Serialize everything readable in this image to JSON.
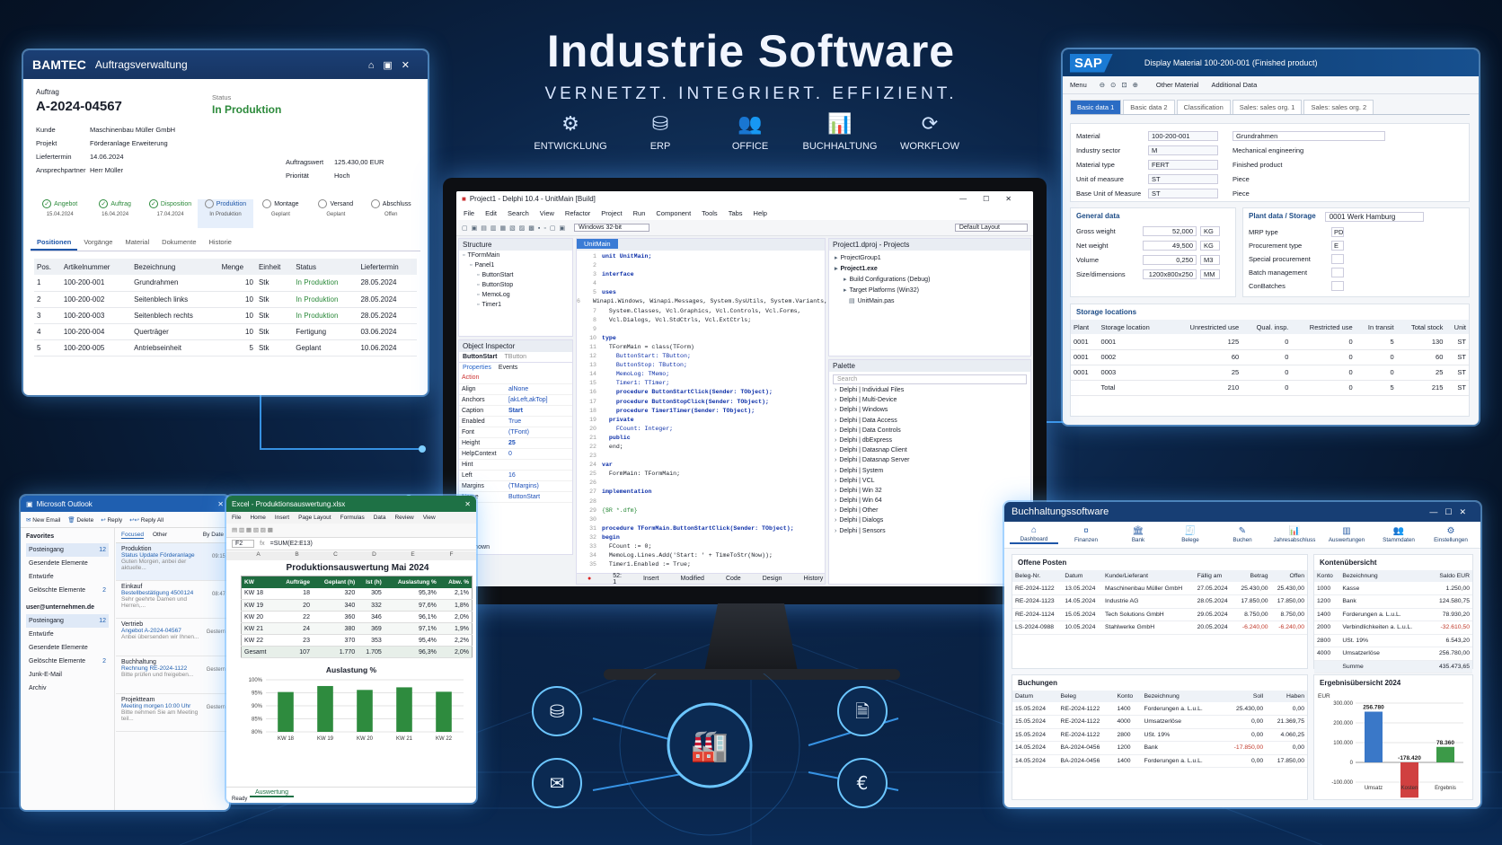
{
  "hero": {
    "title": "Industrie Software",
    "tagline": "VERNETZT. INTEGRIERT. EFFIZIENT.",
    "categories": [
      {
        "label": "ENTWICKLUNG",
        "icon": "gear-icon"
      },
      {
        "label": "ERP",
        "icon": "database-icon"
      },
      {
        "label": "OFFICE",
        "icon": "people-icon"
      },
      {
        "label": "BUCHHALTUNG",
        "icon": "chart-icon"
      },
      {
        "label": "WORKFLOW",
        "icon": "refresh-icon"
      }
    ]
  },
  "bamtec": {
    "brand": "BAMTEC",
    "title": "Auftragsverwaltung",
    "auftrag_label": "Auftrag",
    "auftrag_no": "A-2024-04567",
    "status_label": "Status",
    "status": "In Produktion",
    "fields": [
      {
        "label": "Kunde",
        "value": "Maschinenbau Müller GmbH"
      },
      {
        "label": "Projekt",
        "value": "Förderanlage Erweiterung"
      },
      {
        "label": "Liefertermin",
        "value": "14.06.2024"
      },
      {
        "label": "Ansprechpartner",
        "value": "Herr Müller"
      }
    ],
    "fields_right": [
      {
        "label": "Auftragswert",
        "value": "125.430,00 EUR"
      },
      {
        "label": "Priorität",
        "value": "Hoch"
      }
    ],
    "steps": [
      {
        "label": "Angebot",
        "date": "15.04.2024"
      },
      {
        "label": "Auftrag",
        "date": "16.04.2024"
      },
      {
        "label": "Disposition",
        "date": "17.04.2024"
      },
      {
        "label": "Produktion",
        "date": "In Produktion"
      },
      {
        "label": "Montage",
        "date": "Geplant"
      },
      {
        "label": "Versand",
        "date": "Geplant"
      },
      {
        "label": "Abschluss",
        "date": "Offen"
      }
    ],
    "tabs": [
      "Positionen",
      "Vorgänge",
      "Material",
      "Dokumente",
      "Historie"
    ],
    "columns": [
      "Pos.",
      "Artikelnummer",
      "Bezeichnung",
      "Menge",
      "Einheit",
      "Status",
      "Liefertermin"
    ],
    "rows": [
      [
        "1",
        "100-200-001",
        "Grundrahmen",
        "10",
        "Stk",
        "In Produktion",
        "28.05.2024"
      ],
      [
        "2",
        "100-200-002",
        "Seitenblech links",
        "10",
        "Stk",
        "In Produktion",
        "28.05.2024"
      ],
      [
        "3",
        "100-200-003",
        "Seitenblech rechts",
        "10",
        "Stk",
        "In Produktion",
        "28.05.2024"
      ],
      [
        "4",
        "100-200-004",
        "Querträger",
        "10",
        "Stk",
        "Fertigung",
        "03.06.2024"
      ],
      [
        "5",
        "100-200-005",
        "Antriebseinheit",
        "5",
        "Stk",
        "Geplant",
        "10.06.2024"
      ]
    ]
  },
  "sap": {
    "logo": "SAP",
    "title": "Display Material 100-200-001 (Finished product)",
    "menu": "Menu",
    "toolbar_items": [
      "Other Material",
      "Additional Data"
    ],
    "tabs": [
      "Basic data 1",
      "Basic data 2",
      "Classification",
      "Sales: sales org. 1",
      "Sales: sales org. 2"
    ],
    "fields": [
      {
        "label": "Material",
        "value": "100-200-001",
        "extra": "Grundrahmen"
      },
      {
        "label": "Industry sector",
        "value": "M",
        "extra": "Mechanical engineering"
      },
      {
        "label": "Material type",
        "value": "FERT",
        "extra": "Finished product"
      },
      {
        "label": "Unit of measure",
        "value": "ST",
        "extra": "Piece"
      },
      {
        "label": "Base Unit of Measure",
        "value": "ST",
        "extra": "Piece"
      }
    ],
    "general_title": "General data",
    "general": [
      {
        "label": "Gross weight",
        "value": "52,000",
        "unit": "KG"
      },
      {
        "label": "Net weight",
        "value": "49,500",
        "unit": "KG"
      },
      {
        "label": "Volume",
        "value": "0,250",
        "unit": "M3"
      },
      {
        "label": "Size/dimensions",
        "value": "1200x800x250",
        "unit": "MM"
      }
    ],
    "plant_title": "Plant data / Storage",
    "plant_value": "0001 Werk Hamburg",
    "plant": [
      {
        "label": "MRP type",
        "value": "PD"
      },
      {
        "label": "Procurement type",
        "value": "E"
      },
      {
        "label": "Special procurement",
        "value": ""
      },
      {
        "label": "Batch management",
        "value": ""
      },
      {
        "label": "ConBatches",
        "value": ""
      }
    ],
    "storage_title": "Storage locations",
    "storage_columns": [
      "Plant",
      "Storage location",
      "Unrestricted use",
      "Qual. insp.",
      "Restricted use",
      "In transit",
      "Total stock",
      "Unit"
    ],
    "storage_rows": [
      [
        "0001",
        "0001",
        "125",
        "0",
        "0",
        "5",
        "130",
        "ST"
      ],
      [
        "0001",
        "0002",
        "60",
        "0",
        "0",
        "0",
        "60",
        "ST"
      ],
      [
        "0001",
        "0003",
        "25",
        "0",
        "0",
        "0",
        "25",
        "ST"
      ],
      [
        "",
        "Total",
        "210",
        "0",
        "0",
        "5",
        "215",
        "ST"
      ]
    ]
  },
  "delphi": {
    "title": "Project1 - Delphi 10.4 - UnitMain [Build]",
    "menu": [
      "File",
      "Edit",
      "Search",
      "View",
      "Refactor",
      "Project",
      "Run",
      "Component",
      "Tools",
      "Tabs",
      "Help"
    ],
    "layout": "Default Layout",
    "platform": "Windows 32-bit",
    "structure_title": "Structure",
    "structure": [
      "TFormMain",
      "Panel1",
      "ButtonStart",
      "ButtonStop",
      "MemoLog",
      "Timer1"
    ],
    "inspector_title": "Object Inspector",
    "inspector_obj": "ButtonStart",
    "inspector_type": "TButton",
    "inspector_tabs": [
      "Properties",
      "Events"
    ],
    "props": [
      [
        "Action",
        ""
      ],
      [
        "Align",
        "alNone"
      ],
      [
        "Anchors",
        "[akLeft,akTop]"
      ],
      [
        "Caption",
        "Start"
      ],
      [
        "Enabled",
        "True"
      ],
      [
        "Font",
        "(TFont)"
      ],
      [
        "Height",
        "25"
      ],
      [
        "HelpContext",
        "0"
      ],
      [
        "Hint",
        ""
      ],
      [
        "Left",
        "16"
      ],
      [
        "Margins",
        "(TMargins)"
      ],
      [
        "Name",
        "ButtonStart"
      ]
    ],
    "all_shown": "All shown",
    "editor_tab": "UnitMain",
    "code": [
      "unit UnitMain;",
      "",
      "interface",
      "",
      "uses",
      "  Winapi.Windows, Winapi.Messages, System.SysUtils, System.Variants,",
      "  System.Classes, Vcl.Graphics, Vcl.Controls, Vcl.Forms,",
      "  Vcl.Dialogs, Vcl.StdCtrls, Vcl.ExtCtrls;",
      "",
      "type",
      "  TFormMain = class(TForm)",
      "    ButtonStart: TButton;",
      "    ButtonStop: TButton;",
      "    MemoLog: TMemo;",
      "    Timer1: TTimer;",
      "    procedure ButtonStartClick(Sender: TObject);",
      "    procedure ButtonStopClick(Sender: TObject);",
      "    procedure Timer1Timer(Sender: TObject);",
      "  private",
      "    FCount: Integer;",
      "  public",
      "  end;",
      "",
      "var",
      "  FormMain: TFormMain;",
      "",
      "implementation",
      "",
      "{$R *.dfm}",
      "",
      "procedure TFormMain.ButtonStartClick(Sender: TObject);",
      "begin",
      "  FCount := 0;",
      "  MemoLog.Lines.Add('Start: ' + TimeToStr(Now));",
      "  Timer1.Enabled := True;"
    ],
    "status": [
      "52: 1",
      "Insert",
      "Modified"
    ],
    "editor_tabs": [
      "Code",
      "Design",
      "History"
    ],
    "projects_title": "Project1.dproj - Projects",
    "projects": [
      "ProjectGroup1",
      "Project1.exe",
      "Build Configurations (Debug)",
      "Target Platforms (Win32)",
      "UnitMain.pas"
    ],
    "palette_title": "Palette",
    "palette_search": "Search",
    "palette": [
      "Delphi | Individual Files",
      "Delphi | Multi-Device",
      "Delphi | Windows",
      "Delphi | Data Access",
      "Delphi | Data Controls",
      "Delphi | dbExpress",
      "Delphi | Datasnap Client",
      "Delphi | Datasnap Server",
      "Delphi | System",
      "Delphi | VCL",
      "Delphi | Win 32",
      "Delphi | Win 64",
      "Delphi | Other",
      "Delphi | Dialogs",
      "Delphi | Sensors"
    ]
  },
  "outlook": {
    "title": "Microsoft Outlook",
    "toolbar": [
      "New Email",
      "Delete",
      "Reply",
      "Reply All"
    ],
    "favorites_title": "Favorites",
    "favorites": [
      {
        "label": "Posteingang",
        "count": "12"
      },
      {
        "label": "Gesendete Elemente",
        "count": ""
      },
      {
        "label": "Entwürfe",
        "count": ""
      },
      {
        "label": "Gelöschte Elemente",
        "count": "2"
      }
    ],
    "account": "user@unternehmen.de",
    "folders": [
      {
        "label": "Posteingang",
        "count": "12"
      },
      {
        "label": "Entwürfe",
        "count": ""
      },
      {
        "label": "Gesendete Elemente",
        "count": ""
      },
      {
        "label": "Gelöschte Elemente",
        "count": "2"
      },
      {
        "label": "Junk-E-Mail",
        "count": ""
      },
      {
        "label": "Archiv",
        "count": ""
      }
    ],
    "list_tabs": [
      "Focused",
      "Other",
      "By Date"
    ],
    "mails": [
      {
        "from": "Produktion",
        "subject": "Status Update Förderanlage",
        "preview": "Guten Morgen, anbei der aktuelle...",
        "time": "09:15"
      },
      {
        "from": "Einkauf",
        "subject": "Bestellbestätigung 4500124",
        "preview": "Sehr geehrte Damen und Herren,...",
        "time": "08:47"
      },
      {
        "from": "Vertrieb",
        "subject": "Angebot A-2024-04567",
        "preview": "Anbei übersenden wir Ihnen...",
        "time": "Gestern"
      },
      {
        "from": "Buchhaltung",
        "subject": "Rechnung RE-2024-1122",
        "preview": "Bitte prüfen und freigeben...",
        "time": "Gestern"
      },
      {
        "from": "Projektteam",
        "subject": "Meeting morgen 10:00 Uhr",
        "preview": "Bitte nehmen Sie am Meeting teil...",
        "time": "Gestern"
      }
    ]
  },
  "excel": {
    "title": "Excel - Produktionsauswertung.xlsx",
    "ribbon": [
      "File",
      "Home",
      "Insert",
      "Page Layout",
      "Formulas",
      "Data",
      "Review",
      "View"
    ],
    "cell": "F2",
    "formula": "=SUM(E2:E13)",
    "sheet_title": "Produktionsauswertung Mai 2024",
    "col_letters": [
      "A",
      "B",
      "C",
      "D",
      "E",
      "F"
    ],
    "columns": [
      "KW",
      "Aufträge",
      "Geplant (h)",
      "Ist (h)",
      "Auslastung %",
      "Abw. %"
    ],
    "rows": [
      [
        "KW 18",
        "18",
        "320",
        "305",
        "95,3%",
        "2,1%"
      ],
      [
        "KW 19",
        "20",
        "340",
        "332",
        "97,6%",
        "1,8%"
      ],
      [
        "KW 20",
        "22",
        "360",
        "346",
        "96,1%",
        "2,0%"
      ],
      [
        "KW 21",
        "24",
        "380",
        "369",
        "97,1%",
        "1,9%"
      ],
      [
        "KW 22",
        "23",
        "370",
        "353",
        "95,4%",
        "2,2%"
      ],
      [
        "Gesamt",
        "107",
        "1.770",
        "1.705",
        "96,3%",
        "2,0%"
      ]
    ],
    "sheet_tab": "Auswertung",
    "status": "Ready"
  },
  "buch": {
    "title": "Buchhaltungssoftware",
    "nav": [
      {
        "label": "Dashboard",
        "icon": "home-icon"
      },
      {
        "label": "Finanzen",
        "icon": "coins-icon"
      },
      {
        "label": "Bank",
        "icon": "bank-icon"
      },
      {
        "label": "Belege",
        "icon": "receipt-icon"
      },
      {
        "label": "Buchen",
        "icon": "pen-icon"
      },
      {
        "label": "Jahresabschluss",
        "icon": "chart-icon"
      },
      {
        "label": "Auswertungen",
        "icon": "bar-chart-icon"
      },
      {
        "label": "Stammdaten",
        "icon": "people-icon"
      },
      {
        "label": "Einstellungen",
        "icon": "gear-icon"
      }
    ],
    "op_title": "Offene Posten",
    "op_columns": [
      "Beleg-Nr.",
      "Datum",
      "Kunde/Lieferant",
      "Fällig am",
      "Betrag",
      "Offen"
    ],
    "op_rows": [
      [
        "RE-2024-1122",
        "13.05.2024",
        "Maschinenbau Müller GmbH",
        "27.05.2024",
        "25.430,00",
        "25.430,00"
      ],
      [
        "RE-2024-1123",
        "14.05.2024",
        "Industrie AG",
        "28.05.2024",
        "17.850,00",
        "17.850,00"
      ],
      [
        "RE-2024-1124",
        "15.05.2024",
        "Tech Solutions GmbH",
        "29.05.2024",
        "8.750,00",
        "8.750,00"
      ],
      [
        "LS-2024-0988",
        "10.05.2024",
        "Stahlwerke GmbH",
        "20.05.2024",
        "-6.240,00",
        "-6.240,00"
      ]
    ],
    "ko_title": "Kontenübersicht",
    "ko_columns": [
      "Konto",
      "Bezeichnung",
      "Saldo EUR"
    ],
    "ko_rows": [
      [
        "1000",
        "Kasse",
        "1.250,00"
      ],
      [
        "1200",
        "Bank",
        "124.580,75"
      ],
      [
        "1400",
        "Forderungen a. L.u.L.",
        "78.930,20"
      ],
      [
        "2000",
        "Verbindlichkeiten a. L.u.L.",
        "-32.610,50"
      ],
      [
        "2800",
        "USt. 19%",
        "6.543,20"
      ],
      [
        "4000",
        "Umsatzerlöse",
        "256.780,00"
      ],
      [
        "",
        "Summe",
        "435.473,65"
      ]
    ],
    "bu_title": "Buchungen",
    "bu_columns": [
      "Datum",
      "Beleg",
      "Konto",
      "Bezeichnung",
      "Soll",
      "Haben"
    ],
    "bu_rows": [
      [
        "15.05.2024",
        "RE-2024-1122",
        "1400",
        "Forderungen a. L.u.L.",
        "25.430,00",
        "0,00"
      ],
      [
        "15.05.2024",
        "RE-2024-1122",
        "4000",
        "Umsatzerlöse",
        "0,00",
        "21.369,75"
      ],
      [
        "15.05.2024",
        "RE-2024-1122",
        "2800",
        "USt. 19%",
        "0,00",
        "4.060,25"
      ],
      [
        "14.05.2024",
        "BA-2024-0456",
        "1200",
        "Bank",
        "-17.850,00",
        "0,00"
      ],
      [
        "14.05.2024",
        "BA-2024-0456",
        "1400",
        "Forderungen a. L.u.L.",
        "0,00",
        "17.850,00"
      ]
    ],
    "erg_title": "Ergebnisübersicht 2024"
  },
  "hub_icons": [
    "database-icon",
    "document-icon",
    "mail-icon",
    "euro-icon",
    "factory-icon"
  ],
  "chart_data": [
    {
      "type": "bar",
      "title": "Auslastung %",
      "categories": [
        "KW 18",
        "KW 19",
        "KW 20",
        "KW 21",
        "KW 22"
      ],
      "values": [
        95.3,
        97.6,
        96.1,
        97.1,
        95.4
      ],
      "ylim": [
        80,
        100
      ],
      "yticks": [
        "80%",
        "85%",
        "90%",
        "95%",
        "100%"
      ],
      "color": "#2e8b3e",
      "grid": true
    },
    {
      "type": "bar",
      "title": "Ergebnisübersicht 2024",
      "ylabel": "EUR",
      "categories": [
        "Umsatz",
        "Kosten",
        "Ergebnis"
      ],
      "values": [
        256780,
        -178420,
        78360
      ],
      "labels": [
        "256.780",
        "-178.420",
        "78.360"
      ],
      "ylim": [
        -100000,
        300000
      ],
      "yticks": [
        "-100.000",
        "0",
        "100.000",
        "200.000",
        "300.000"
      ],
      "colors": [
        "#3a78c8",
        "#d04040",
        "#3c9a48"
      ]
    }
  ]
}
